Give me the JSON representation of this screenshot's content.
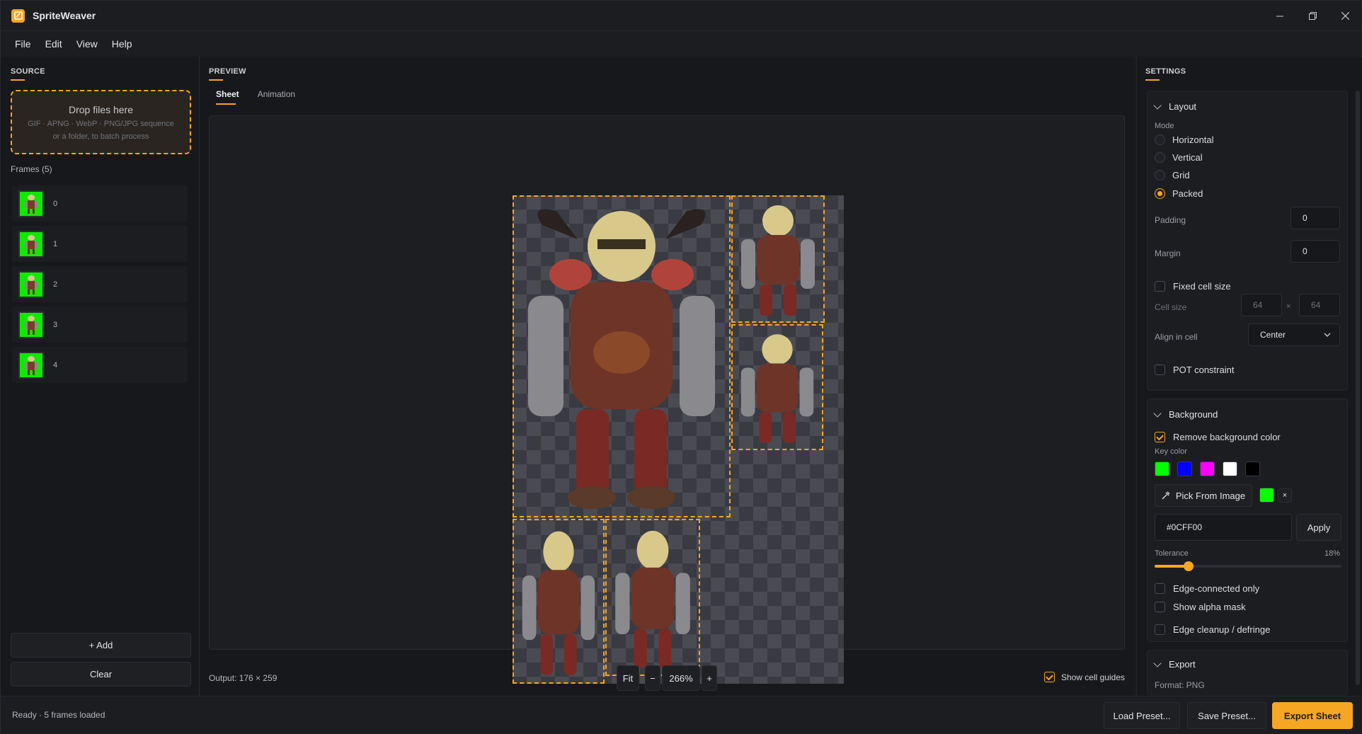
{
  "app": {
    "title": "SpriteWeaver"
  },
  "menu": [
    "File",
    "Edit",
    "View",
    "Help"
  ],
  "source": {
    "title": "SOURCE",
    "drop_title": "Drop files here",
    "drop_line1": "GIF · APNG · WebP · PNG/JPG sequence",
    "drop_line2": "or a folder, to batch process",
    "frames_label": "Frames (5)",
    "frames": [
      "0",
      "1",
      "2",
      "3",
      "4"
    ],
    "add_label": "+ Add",
    "clear_label": "Clear"
  },
  "preview": {
    "title": "PREVIEW",
    "tabs": [
      "Sheet",
      "Animation"
    ],
    "active_tab": "Sheet",
    "output_label": "Output: 176 × 259",
    "fit_label": "Fit",
    "zoom_out": "−",
    "zoom_value": "266%",
    "zoom_in": "+",
    "guides_label": "Show cell guides",
    "guides_checked": true
  },
  "settings": {
    "title": "SETTINGS",
    "layout": {
      "header": "Layout",
      "mode_label": "Mode",
      "modes": [
        "Horizontal",
        "Vertical",
        "Grid",
        "Packed"
      ],
      "selected_mode": "Packed",
      "padding_label": "Padding",
      "padding_value": "0",
      "margin_label": "Margin",
      "margin_value": "0",
      "fixed_cell_label": "Fixed cell size",
      "cell_size_label": "Cell size",
      "cell_w": "64",
      "cell_x": "×",
      "cell_h": "64",
      "align_label": "Align in cell",
      "align_value": "Center",
      "pot_label": "POT constraint"
    },
    "background": {
      "header": "Background",
      "remove_label": "Remove background color",
      "key_color_label": "Key color",
      "swatches": [
        "#00ff00",
        "#0000ff",
        "#ff00ff",
        "#ffffff",
        "#000000"
      ],
      "pick_label": "Pick From Image",
      "current_color": "#0cff00",
      "clear_x": "×",
      "hex_value": "#0CFF00",
      "apply_label": "Apply",
      "tolerance_label": "Tolerance",
      "tolerance_value": "18%",
      "tolerance_fraction": 0.18,
      "edge_connected_label": "Edge-connected only",
      "alpha_mask_label": "Show alpha mask",
      "cleanup_label": "Edge cleanup / defringe"
    },
    "export": {
      "header": "Export",
      "format_label": "Format: PNG"
    }
  },
  "status": {
    "text": "Ready · 5 frames loaded",
    "load_preset": "Load Preset...",
    "save_preset": "Save Preset...",
    "export_sheet": "Export Sheet"
  },
  "colors": {
    "accent": "#f5a623",
    "key_green": "#0cff00"
  }
}
